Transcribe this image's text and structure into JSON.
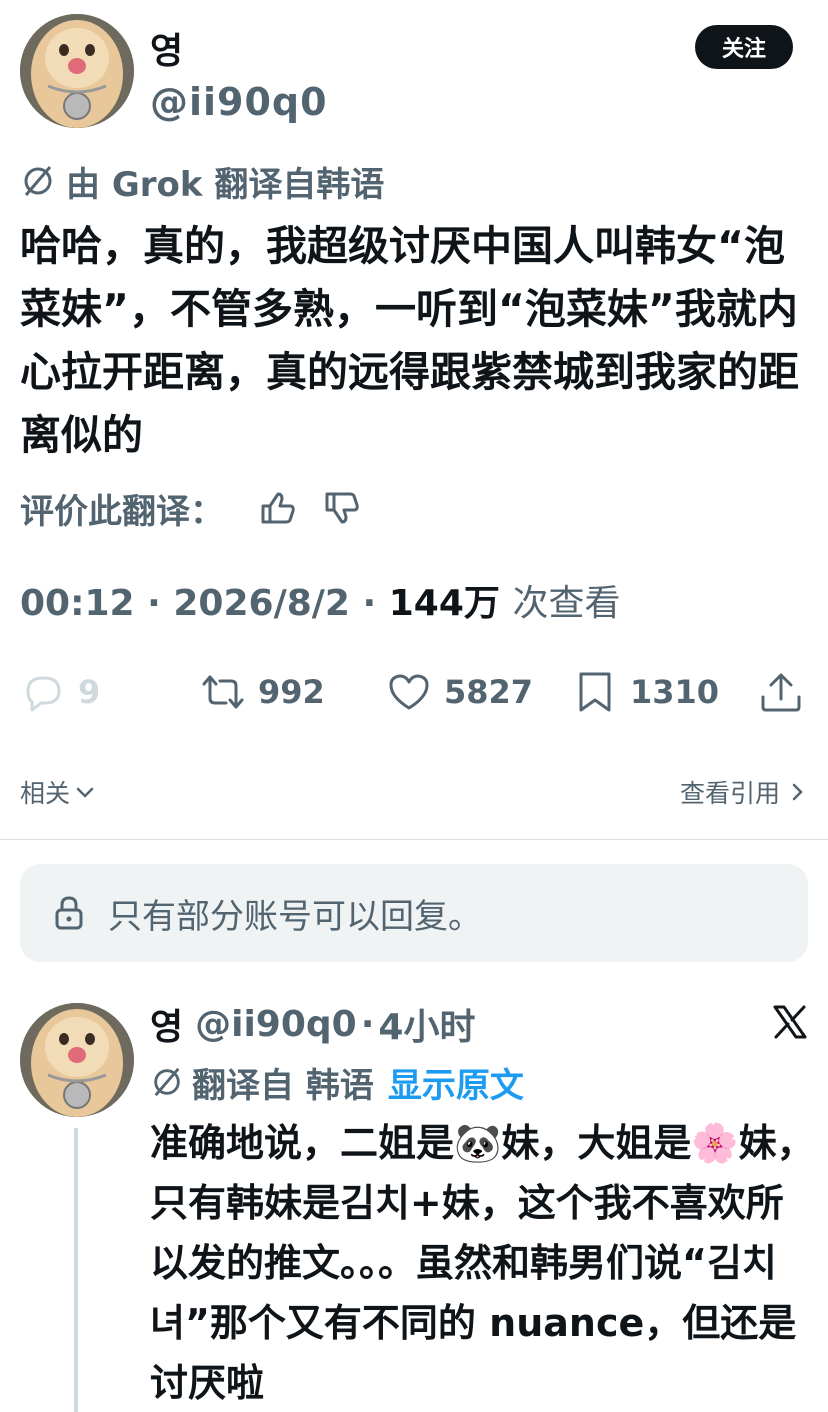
{
  "tweet": {
    "display_name": "영",
    "handle": "@ii90q0",
    "follow_label": "关注",
    "translation_note": "由 Grok 翻译自韩语",
    "text": "哈哈，真的，我超级讨厌中国人叫韩女“泡菜妹”，不管多熟，一听到“泡菜妹”我就内心拉开距离，真的远得跟紫禁城到我家的距离似的",
    "rate_label": "评价此翻译：",
    "time": "00:12",
    "date": "2026/8/2",
    "views_count": "144万",
    "views_label": "次查看",
    "separator": "·"
  },
  "actions": {
    "replies": "9",
    "retweets": "992",
    "likes": "5827",
    "bookmarks": "1310"
  },
  "related": {
    "left_label": "相关",
    "right_label": "查看引用"
  },
  "reply_restriction": "只有部分账号可以回复。",
  "reply": {
    "display_name": "영",
    "handle": "@ii90q0",
    "separator": "·",
    "time": "4小时",
    "translation_note": "翻译自 韩语",
    "show_original": "显示原文",
    "text": "准确地说，二姐是🐼妹，大姐是🌸妹，只有韩妹是김치+妹，这个我不喜欢所以发的推文。。。虽然和韩男们说“김치녀”那个又有不同的 nuance，但还是讨厌啦"
  },
  "colors": {
    "text_primary": "#0f1419",
    "text_secondary": "#536471",
    "accent": "#1d9bf0",
    "reply_bg": "#eff3f4"
  }
}
